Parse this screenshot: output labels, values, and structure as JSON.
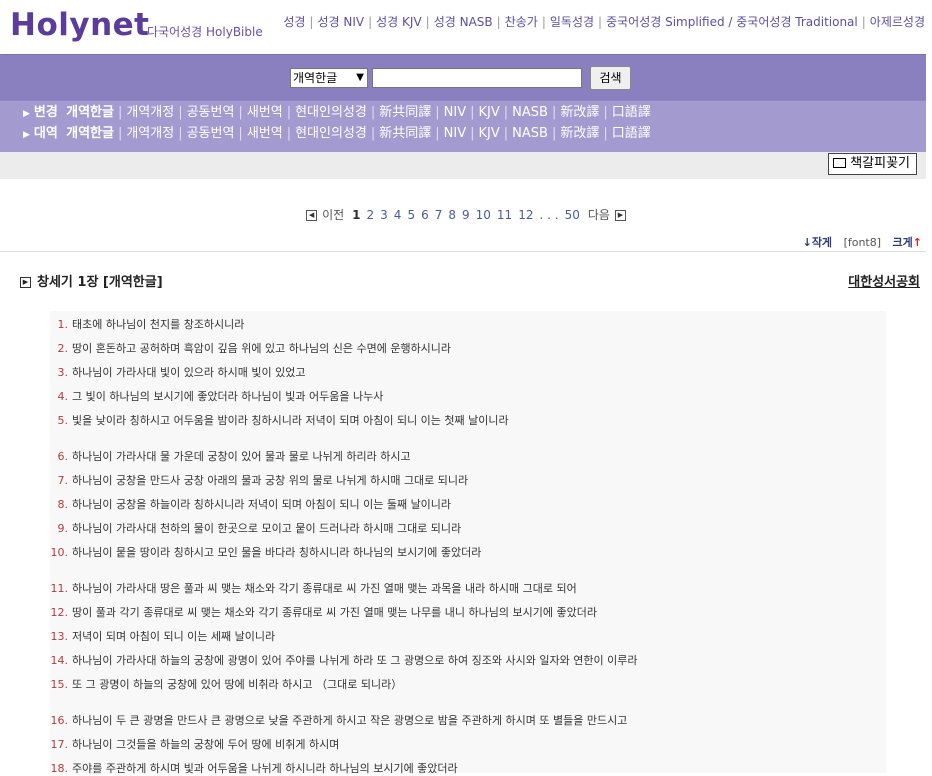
{
  "header": {
    "logo": "Holynet",
    "tagline": "다국어성경 HolyBible",
    "nav_links": [
      "성경",
      "성경 NIV",
      "성경 KJV",
      "성경 NASB",
      "찬송가",
      "일독성경",
      "중국어성경 Simplified / 중국어성경 Traditional",
      "아제르성경"
    ]
  },
  "search": {
    "version_selected": "개역한글",
    "input_value": "",
    "button_label": "검색"
  },
  "version_rows": [
    {
      "label": "변경",
      "items": [
        "개역한글",
        "개역개정",
        "공동번역",
        "새번역",
        "현대인의성경",
        "新共同譯",
        "NIV",
        "KJV",
        "NASB",
        "新改譯",
        "口語譯"
      ]
    },
    {
      "label": "대역",
      "items": [
        "개역한글",
        "개역개정",
        "공동번역",
        "새번역",
        "현대인의성경",
        "新共同譯",
        "NIV",
        "KJV",
        "NASB",
        "新改譯",
        "口語譯"
      ]
    }
  ],
  "toolbar": {
    "bookmark_label": "책갈피꽂기"
  },
  "pager": {
    "prev_label": "이전",
    "next_label": "다음",
    "pages": [
      "1",
      "2",
      "3",
      "4",
      "5",
      "6",
      "7",
      "8",
      "9",
      "10",
      "11",
      "12"
    ],
    "ellipsis": ". . .",
    "last_page": "50",
    "current": "1"
  },
  "font_controls": {
    "smaller": "작게",
    "current": "[font8]",
    "larger": "크게"
  },
  "chapter": {
    "title": "창세기 1장 [개역한글]",
    "publisher": "대한성서공회"
  },
  "verses": [
    {
      "n": "1.",
      "text": "태초에 하나님이 천지를 창조하시니라"
    },
    {
      "n": "2.",
      "text": "땅이 혼돈하고 공허하며 흑암이 깊음 위에 있고 하나님의 신은 수면에 운행하시니라"
    },
    {
      "n": "3.",
      "text": "하나님이 가라사대 빛이 있으라 하시매 빛이 있었고"
    },
    {
      "n": "4.",
      "text": "그 빛이 하나님의 보시기에 좋았더라 하나님이 빛과 어두움을 나누사"
    },
    {
      "n": "5.",
      "text": "빛을 낮이라 칭하시고 어두움을 밤이라 칭하시니라 저녁이 되며 아침이 되니 이는 첫째 날이니라"
    },
    {
      "n": "6.",
      "text": "하나님이 가라사대 물 가운데 궁창이 있어 물과 물로 나뉘게 하리라 하시고"
    },
    {
      "n": "7.",
      "text": "하나님이 궁창을 만드사 궁창 아래의 물과 궁창 위의 물로 나뉘게 하시매 그대로 되니라"
    },
    {
      "n": "8.",
      "text": "하나님이 궁창을 하늘이라 칭하시니라 저녁이 되며 아침이 되니 이는 둘째 날이니라"
    },
    {
      "n": "9.",
      "text": "하나님이 가라사대 천하의 물이 한곳으로 모이고 뭍이 드러나라 하시매 그대로 되니라"
    },
    {
      "n": "10.",
      "text": "하나님이 뭍을 땅이라 칭하시고 모인 물을 바다라 칭하시니라 하나님의 보시기에 좋았더라"
    },
    {
      "n": "11.",
      "text": "하나님이 가라사대 땅은 풀과 씨 맺는 채소와 각기 종류대로 씨 가진 열매 맺는 과목을 내라 하시매 그대로 되어"
    },
    {
      "n": "12.",
      "text": "땅이 풀과 각기 종류대로 씨 맺는 채소와 각기 종류대로 씨 가진 열매 맺는 나무를 내니 하나님의 보시기에 좋았더라"
    },
    {
      "n": "13.",
      "text": "저녁이 되며 아침이 되니 이는 세째 날이니라"
    },
    {
      "n": "14.",
      "text": "하나님이 가라사대 하늘의 궁창에 광명이 있어 주야를 나뉘게 하라 또 그 광명으로 하여 징조와 사시와 일자와 연한이 이루라"
    },
    {
      "n": "15.",
      "text": "또 그 광명이 하늘의 궁창에 있어 땅에 비취라 하시고 （그대로 되니라）"
    },
    {
      "n": "16.",
      "text": "하나님이 두 큰 광명을 만드사 큰 광명으로 낮을 주관하게 하시고 작은 광명으로 밤을 주관하게 하시며 또 별들을 만드시고"
    },
    {
      "n": "17.",
      "text": "하나님이 그것들을 하늘의 궁창에 두어 땅에 비취게 하시며"
    },
    {
      "n": "18.",
      "text": "주야를 주관하게 하시며 빛과 어두움을 나뉘게 하시니라 하나님의 보시기에 좋았더라"
    }
  ]
}
